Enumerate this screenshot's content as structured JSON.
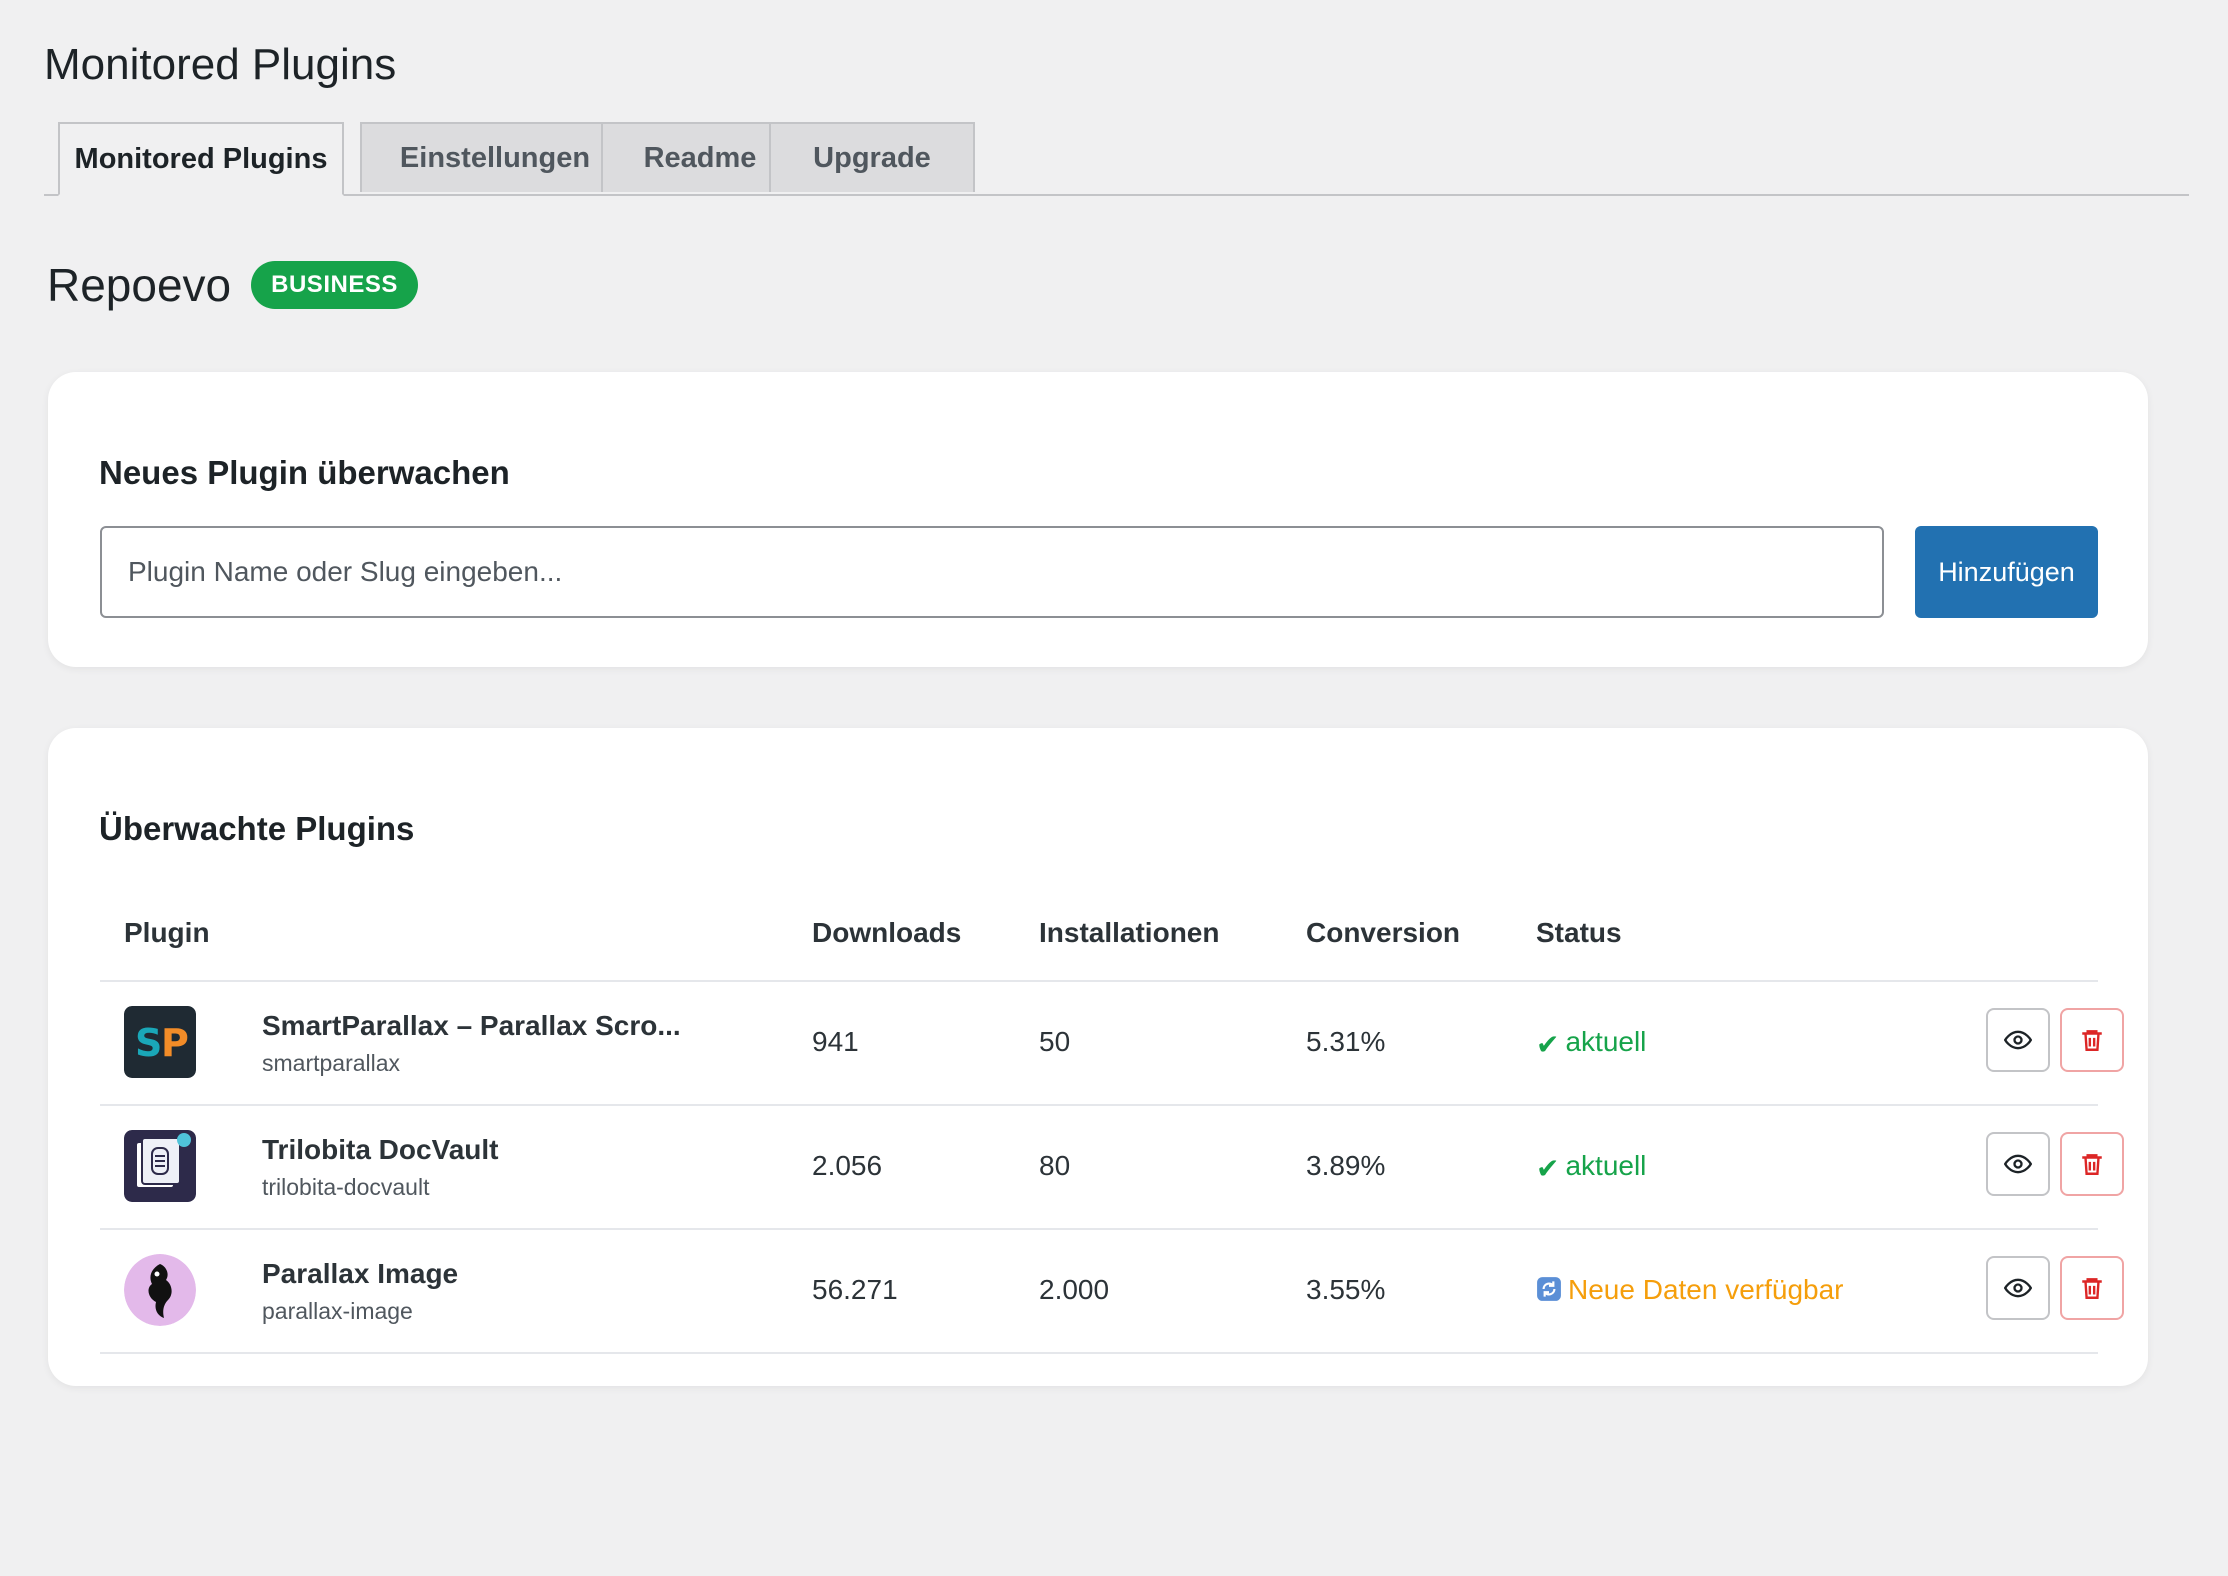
{
  "page": {
    "title": "Monitored Plugins"
  },
  "tabs": [
    {
      "label": "Monitored Plugins",
      "active": true
    },
    {
      "label": "Einstellungen",
      "active": false
    },
    {
      "label": "Readme",
      "active": false
    },
    {
      "label": "Upgrade",
      "active": false
    }
  ],
  "brand": {
    "name": "Repoevo",
    "badge": "BUSINESS",
    "badge_color": "#16a34a"
  },
  "add_card": {
    "title": "Neues Plugin überwachen",
    "input_placeholder": "Plugin Name oder Slug eingeben...",
    "input_value": "",
    "button_label": "Hinzufügen",
    "button_color": "#2271b1"
  },
  "list_card": {
    "title": "Überwachte Plugins",
    "columns": [
      "Plugin",
      "Downloads",
      "Installationen",
      "Conversion",
      "Status"
    ],
    "rows": [
      {
        "icon": "smartparallax-logo-icon",
        "name": "SmartParallax – Parallax Scro...",
        "slug": "smartparallax",
        "downloads": "941",
        "installs": "50",
        "conversion": "5.31%",
        "status_icon": "check-icon",
        "status": "aktuell",
        "status_color": "#16a34a"
      },
      {
        "icon": "docvault-logo-icon",
        "name": "Trilobita DocVault",
        "slug": "trilobita-docvault",
        "downloads": "2.056",
        "installs": "80",
        "conversion": "3.89%",
        "status_icon": "check-icon",
        "status": "aktuell",
        "status_color": "#16a34a"
      },
      {
        "icon": "parallax-image-logo-icon",
        "name": "Parallax Image",
        "slug": "parallax-image",
        "downloads": "56.271",
        "installs": "2.000",
        "conversion": "3.55%",
        "status_icon": "refresh-icon",
        "status": "Neue Daten verfügbar",
        "status_color": "#f59e0b"
      }
    ],
    "row_actions": {
      "view_icon": "eye-icon",
      "delete_icon": "trash-icon",
      "delete_color": "#dc2626"
    }
  }
}
